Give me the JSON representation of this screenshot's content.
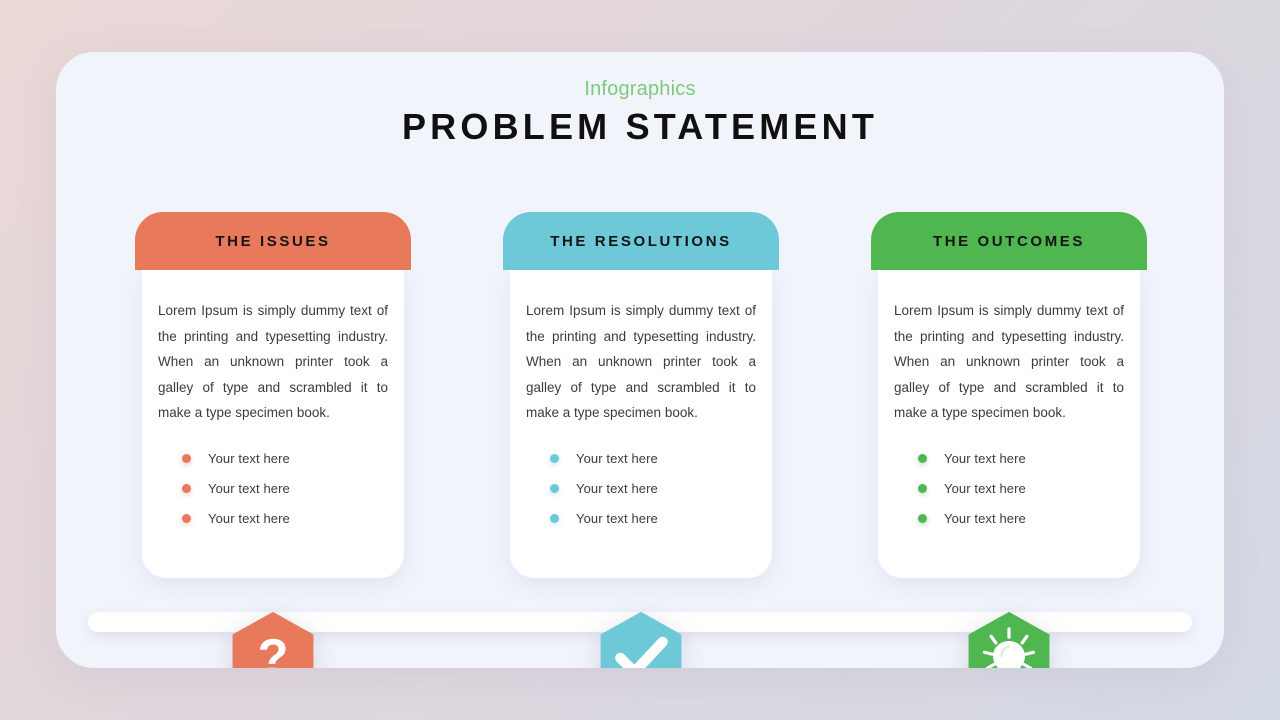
{
  "slide": {
    "eyebrow": "Infographics",
    "title": "PROBLEM STATEMENT",
    "background_top_left": "#ead8d6",
    "background_bottom_right": "#d4dae6",
    "card_background": "#f2f4fc"
  },
  "columns": [
    {
      "id": "issues",
      "header": "THE ISSUES",
      "color": "#e8795b",
      "icon": "question-mark-icon",
      "paragraph": "Lorem Ipsum is simply dummy text of the printing and typesetting industry. When an unknown printer took a galley of type and scrambled it to make a type specimen book.",
      "bullets": [
        "Your text here",
        "Your text here",
        "Your text here"
      ]
    },
    {
      "id": "resolutions",
      "header": "THE RESOLUTIONS",
      "color": "#6dc8d8",
      "icon": "check-mark-icon",
      "paragraph": "Lorem Ipsum is simply dummy text of the printing and typesetting industry. When an unknown printer took a galley of type and scrambled it to make a type specimen book.",
      "bullets": [
        "Your text here",
        "Your text here",
        "Your text here"
      ]
    },
    {
      "id": "outcomes",
      "header": "THE OUTCOMES",
      "color": "#50b64f",
      "icon": "light-bulb-icon",
      "paragraph": "Lorem Ipsum is simply dummy text of the printing and typesetting industry. When an unknown printer took a galley of type and scrambled it to make a type specimen book.",
      "bullets": [
        "Your text here",
        "Your text here",
        "Your text here"
      ]
    }
  ]
}
